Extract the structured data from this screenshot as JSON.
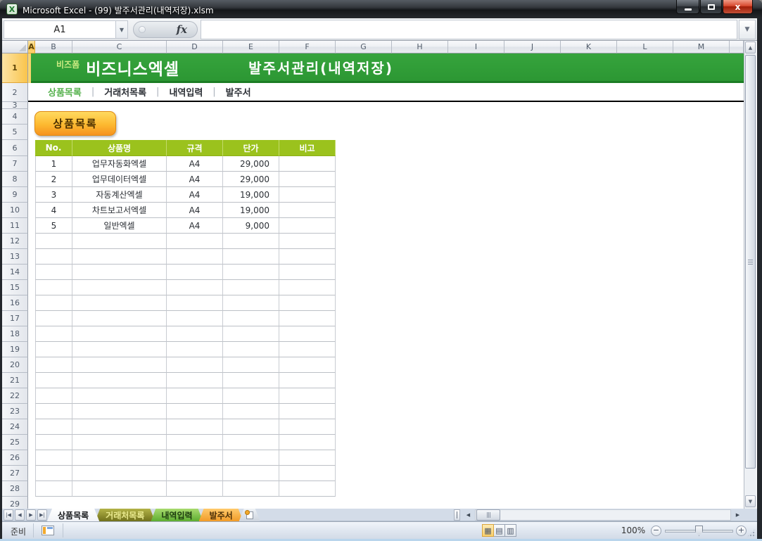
{
  "window": {
    "title": "Microsoft Excel - (99) 발주서관리(내역저장).xlsm"
  },
  "formula_bar": {
    "name_box": "A1",
    "fx_label": "fx",
    "formula_value": ""
  },
  "grid": {
    "columns": [
      "A",
      "B",
      "C",
      "D",
      "E",
      "F",
      "G",
      "H",
      "I",
      "J",
      "K",
      "L",
      "M"
    ],
    "row_count": 29,
    "selected_cell": "A1",
    "selected_column": "A",
    "selected_row": "1"
  },
  "banner": {
    "brand_small": "비즈폼",
    "brand_large": "비즈니스엑셀",
    "title": "발주서관리(내역저장)"
  },
  "nav_menu": {
    "separator": "|",
    "items": [
      {
        "label": "상품목록",
        "active": true
      },
      {
        "label": "거래처목록",
        "active": false
      },
      {
        "label": "내역입력",
        "active": false
      },
      {
        "label": "발주서",
        "active": false
      }
    ]
  },
  "section_button": {
    "label": "상품목록"
  },
  "product_table": {
    "headers": [
      "No.",
      "상품명",
      "규격",
      "단가",
      "비고"
    ],
    "rows": [
      {
        "no": "1",
        "name": "업무자동화엑셀",
        "spec": "A4",
        "price": "29,000",
        "note": ""
      },
      {
        "no": "2",
        "name": "업무데이터엑셀",
        "spec": "A4",
        "price": "29,000",
        "note": ""
      },
      {
        "no": "3",
        "name": "자동계산엑셀",
        "spec": "A4",
        "price": "19,000",
        "note": ""
      },
      {
        "no": "4",
        "name": "차트보고서엑셀",
        "spec": "A4",
        "price": "19,000",
        "note": ""
      },
      {
        "no": "5",
        "name": "일반엑셀",
        "spec": "A4",
        "price": "9,000",
        "note": ""
      }
    ],
    "empty_row_count": 17
  },
  "sheet_tabs": {
    "tabs": [
      {
        "label": "상품목록",
        "variant": "active"
      },
      {
        "label": "거래처목록",
        "variant": "olive"
      },
      {
        "label": "내역입력",
        "variant": "green"
      },
      {
        "label": "발주서",
        "variant": "orange"
      }
    ]
  },
  "status_bar": {
    "mode": "준비",
    "zoom_level": "100%"
  },
  "colors": {
    "banner_green": "#2f9e38",
    "banner_border_green": "#1c7d24",
    "brand_small_text": "#cdeb82",
    "table_header_green": "#9bc21d",
    "menu_active_green": "#56b14e",
    "button_orange_top": "#ffda60",
    "button_orange_bottom": "#f6921e",
    "header_highlight_amber": "#fbd56e",
    "tab_olive": "#9c9c30",
    "tab_green": "#7cc24a",
    "tab_orange": "#f9b24a",
    "close_button_red": "#c0392b"
  }
}
